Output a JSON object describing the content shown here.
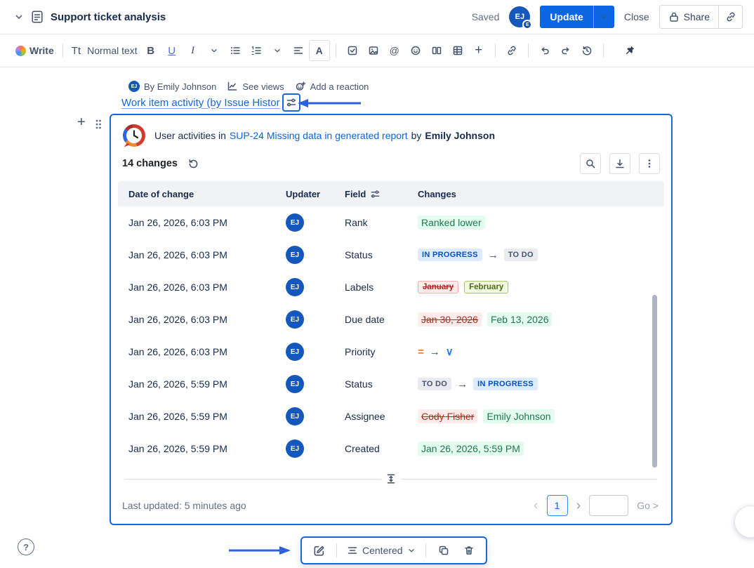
{
  "colors": {
    "accent_blue": "#0C66E4",
    "selection_border": "#1868DB",
    "annotation_arrow": "#2C5FE2",
    "added_bg": "#E3FCEF",
    "added_text": "#1F7A4D",
    "removed_bg": "#FFECEB",
    "removed_text": "#AE2E24",
    "chip_inprogress_bg": "#DEEBFF",
    "chip_inprogress_text": "#0052CC",
    "chip_todo_bg": "#E9EBEE",
    "chip_todo_text": "#44546F",
    "label_added_bg": "#F1FBDE",
    "label_added_text": "#4C6B1F",
    "priority_medium": "#E8792E",
    "priority_low": "#2E7EF5",
    "avatar_bg": "#1558BC"
  },
  "glyphs": {
    "arrow": "→",
    "priority_medium": "=",
    "priority_low": "∨",
    "prev": "‹",
    "next": "›",
    "plus_gutter": "+",
    "question": "?"
  },
  "header": {
    "title": "Support ticket analysis",
    "saved": "Saved",
    "avatar_initials": "EJ",
    "avatar_badge": "E",
    "update": "Update",
    "close": "Close",
    "share": "Share"
  },
  "toolbar": {
    "write": "Write",
    "tt": "Tt",
    "text_style": "Normal text",
    "bold": "B",
    "underline": "U",
    "italic": "I",
    "color_a": "A",
    "mention": "@",
    "plus": "+"
  },
  "byline": {
    "avatar_initials": "EJ",
    "author": "By Emily Johnson",
    "see_views": "See views",
    "add_reaction": "Add a reaction"
  },
  "macro_line": {
    "text": "Work item activity (by Issue Histor"
  },
  "card": {
    "title_prefix": "User activities in",
    "issue_link": "SUP-24 Missing data in generated report",
    "by": "by",
    "author": "Emily Johnson",
    "changes_count": "14 changes",
    "table": {
      "headers": {
        "date": "Date of change",
        "updater": "Updater",
        "field": "Field",
        "changes": "Changes"
      },
      "rows": [
        {
          "date": "Jan 26, 2026, 6:03 PM",
          "updater": "EJ",
          "field": "Rank",
          "changes": [
            {
              "kind": "added-text",
              "text": "Ranked lower"
            }
          ]
        },
        {
          "date": "Jan 26, 2026, 6:03 PM",
          "updater": "EJ",
          "field": "Status",
          "changes": [
            {
              "kind": "chip-inprogress",
              "text": "IN PROGRESS"
            },
            {
              "kind": "arrow"
            },
            {
              "kind": "chip-todo",
              "text": "TO DO"
            }
          ]
        },
        {
          "date": "Jan 26, 2026, 6:03 PM",
          "updater": "EJ",
          "field": "Labels",
          "changes": [
            {
              "kind": "label-removed",
              "text": "January"
            },
            {
              "kind": "label-added",
              "text": "February"
            }
          ]
        },
        {
          "date": "Jan 26, 2026, 6:03 PM",
          "updater": "EJ",
          "field": "Due date",
          "changes": [
            {
              "kind": "removed-text",
              "text": "Jan 30, 2026"
            },
            {
              "kind": "added-text",
              "text": "Feb 13, 2026"
            }
          ]
        },
        {
          "date": "Jan 26, 2026, 6:03 PM",
          "updater": "EJ",
          "field": "Priority",
          "changes": [
            {
              "kind": "priority-medium"
            },
            {
              "kind": "arrow"
            },
            {
              "kind": "priority-low"
            }
          ]
        },
        {
          "date": "Jan 26, 2026, 5:59 PM",
          "updater": "EJ",
          "field": "Status",
          "changes": [
            {
              "kind": "chip-todo",
              "text": "TO DO"
            },
            {
              "kind": "arrow"
            },
            {
              "kind": "chip-inprogress",
              "text": "IN PROGRESS"
            }
          ]
        },
        {
          "date": "Jan 26, 2026, 5:59 PM",
          "updater": "EJ",
          "field": "Assignee",
          "changes": [
            {
              "kind": "removed-text",
              "text": "Cody Fisher"
            },
            {
              "kind": "added-text",
              "text": "Emily Johnson"
            }
          ]
        },
        {
          "date": "Jan 26, 2026, 5:59 PM",
          "updater": "EJ",
          "field": "Created",
          "changes": [
            {
              "kind": "added-text",
              "text": "Jan 26, 2026, 5:59 PM"
            }
          ]
        }
      ]
    },
    "footer": {
      "last_updated": "Last updated: 5 minutes ago",
      "page": "1",
      "go": "Go >"
    }
  },
  "float_toolbar": {
    "layout": "Centered"
  }
}
